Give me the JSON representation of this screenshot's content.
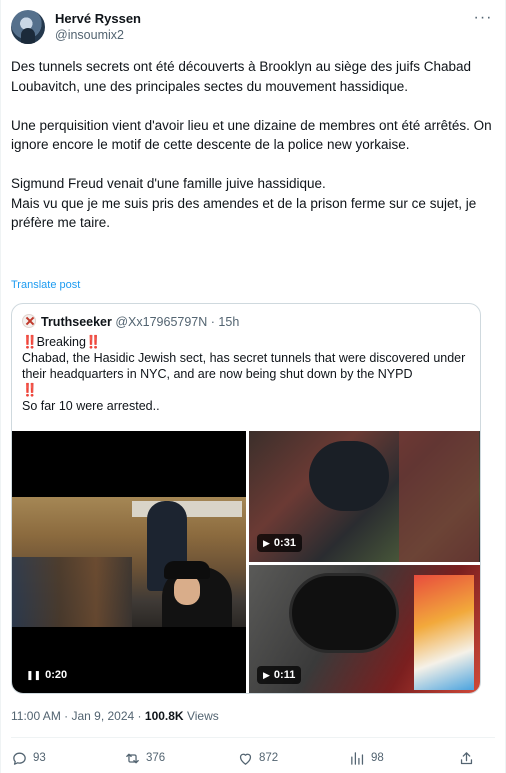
{
  "author": {
    "display_name": "Hervé Ryssen",
    "handle": "@insoumix2"
  },
  "tweet": {
    "paragraphs": [
      "Des tunnels secrets ont été découverts à Brooklyn au siège des juifs Chabad Loubavitch, une des principales sectes du mouvement hassidique.",
      "Une perquisition vient d'avoir lieu et une dizaine de membres ont été arrêtés. On ignore encore le motif de cette descente de la police new yorkaise.",
      "Sigmund Freud venait d'une famille juive hassidique.\nMais vu que je me suis pris des amendes et de la prison ferme sur ce sujet, je préfère me taire."
    ],
    "translate_label": "Translate post"
  },
  "quote": {
    "name": "Truthseeker",
    "handle": "@Xx17965797N",
    "separator": "·",
    "time": "15h",
    "emoji": "‼️",
    "breaking": "Breaking",
    "line2": "Chabad, the Hasidic Jewish sect, has secret tunnels that were discovered under their headquarters in NYC, and are now being shut down by the NYPD",
    "line3": "So far 10 were arrested..",
    "videos": [
      {
        "duration": "0:20",
        "state": "pause"
      },
      {
        "duration": "0:31",
        "state": "play"
      },
      {
        "duration": "0:11",
        "state": "play"
      }
    ]
  },
  "meta": {
    "timestamp": "11:00 AM · Jan 9, 2024",
    "separator": "·",
    "views_count": "100.8K",
    "views_label": "Views"
  },
  "actions": {
    "replies": "93",
    "reposts": "376",
    "likes": "872",
    "bookmarks": "98"
  },
  "icons": {
    "more": "more-icon",
    "reply": "reply-icon",
    "repost": "repost-icon",
    "like": "heart-icon",
    "bookmark": "bookmark-icon",
    "share": "share-icon"
  },
  "colors": {
    "link": "#1d9bf0",
    "muted": "#536471",
    "emoji_red": "#e0245e"
  }
}
